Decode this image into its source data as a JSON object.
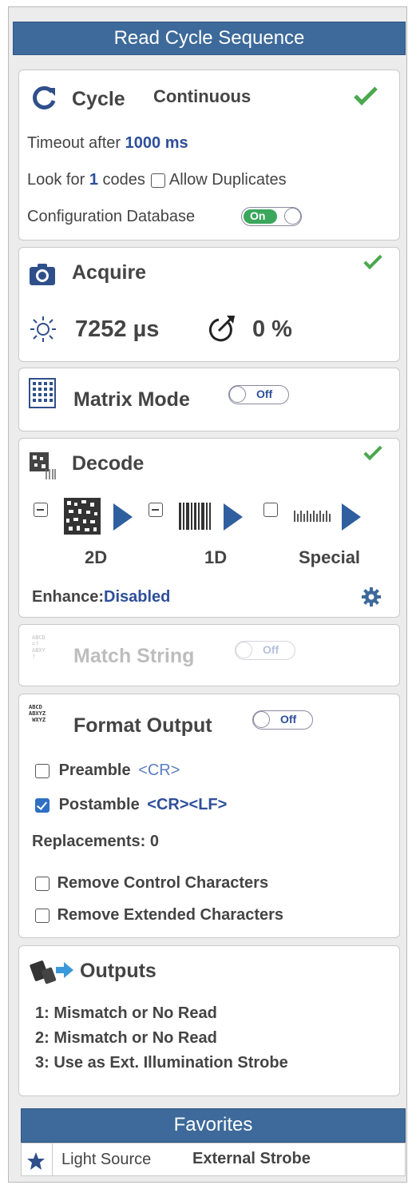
{
  "read_cycle": {
    "header": "Read Cycle Sequence",
    "cycle": {
      "title": "Cycle",
      "mode": "Continuous",
      "timeout_label": "Timeout after",
      "timeout_value": "1000 ms",
      "look_for_label": "Look for",
      "look_for_count": "1",
      "codes_label": "codes",
      "allow_duplicates_label": "Allow Duplicates",
      "allow_duplicates_checked": false,
      "config_db_label": "Configuration Database",
      "config_db_toggle": "On"
    },
    "acquire": {
      "title": "Acquire",
      "exposure": "7252 µs",
      "gain": "0 %"
    },
    "matrix_mode": {
      "title": "Matrix Mode",
      "toggle": "Off"
    },
    "decode": {
      "title": "Decode",
      "symbologies": [
        {
          "label": "2D"
        },
        {
          "label": "1D"
        },
        {
          "label": "Special"
        }
      ],
      "enhance_label": "Enhance:",
      "enhance_value": "Disabled"
    },
    "match_string": {
      "title": "Match String",
      "toggle": "Off"
    },
    "format_output": {
      "title": "Format Output",
      "toggle": "Off",
      "preamble_label": "Preamble",
      "preamble_value": "<CR>",
      "preamble_checked": false,
      "postamble_label": "Postamble",
      "postamble_value": "<CR><LF>",
      "postamble_checked": true,
      "replacements": "Replacements: 0",
      "remove_control": "Remove Control Characters",
      "remove_extended": "Remove Extended Characters"
    },
    "outputs": {
      "title": "Outputs",
      "items": [
        "1: Mismatch or No Read",
        "2: Mismatch or No Read",
        "3: Use as Ext. Illumination Strobe"
      ]
    }
  },
  "favorites": {
    "header": "Favorites",
    "items": [
      {
        "name": "Light Source",
        "value": "External Strobe"
      }
    ]
  },
  "colors": {
    "header_bg": "#3d6a9a",
    "link_blue": "#2e4f9a",
    "check_green": "#4aa84e",
    "toggle_on": "#3aa75c"
  }
}
